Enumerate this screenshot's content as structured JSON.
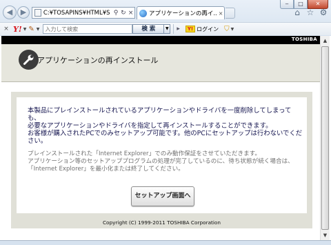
{
  "browser": {
    "address_url": "C:¥TOSAPINS¥HTML¥S",
    "address_search_icon": "search-icon",
    "address_refresh_icon": "refresh-icon",
    "address_close_icon": "close-icon",
    "tab_title": "アプリケーションの再イ...",
    "tab_close": "×",
    "window_buttons": {
      "minimize": "‒",
      "maximize": "□",
      "close": "✕"
    },
    "tools": {
      "home": "⌂",
      "favorites": "☆",
      "settings": "⚙"
    }
  },
  "toolbar": {
    "close_label": "×",
    "yahoo_label": "Y!",
    "search_placeholder": "入力して検索",
    "search_button": "検 索",
    "login_label": "ログイン",
    "login_badge": "Y!"
  },
  "page": {
    "brand": "TOSHIBA",
    "title": "アプリケーションの再インストール",
    "notice_lines": [
      "本製品にプレインストールされているアプリケーションやドライバを一度削除してしまっても、",
      "必要なアプリケーションやドライバを指定して再インストールすることができます。",
      "お客様が購入されたPCでのみセットアップ可能です。他のPCにセットアップは行わないでください。"
    ],
    "note_lines": [
      "プレインストールされた「Internet Explorer」でのみ動作保証をさせていただきます。",
      "アプリケーション等のセットアッププログラムの処理が完了しているのに、待ち状態が続く場合は、「Internet Explorer」を最小化または終了してください。"
    ],
    "setup_button": "セットアップ画面へ",
    "copyright": "Copyright (C) 1999-2011 TOSHIBA Corporation"
  }
}
